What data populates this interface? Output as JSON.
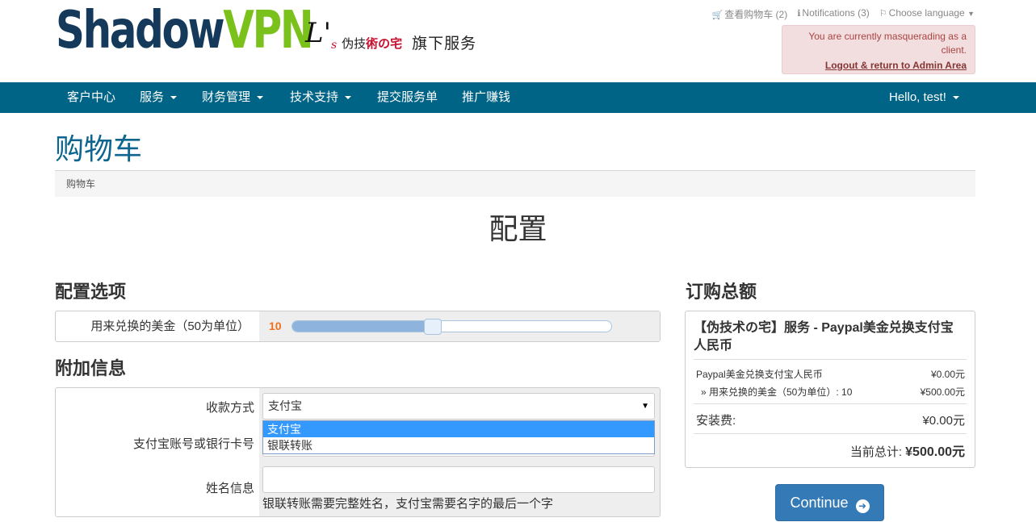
{
  "header": {
    "logo_part1": "Shadow",
    "logo_part2": "VPN",
    "partner_mark": "L'",
    "partner_mark_sub": "s",
    "partner_name_a": "伪技",
    "partner_name_b": "術の",
    "partner_name_c": "宅",
    "partner_tagline": "旗下服务",
    "cart_link": "查看购物车 (2)",
    "notifications_link": "Notifications (3)",
    "language_link": "Choose language",
    "masquerade_text": "You are currently masquerading as a client.",
    "masquerade_link": "Logout & return to Admin Area"
  },
  "nav": {
    "items": [
      {
        "label": "客户中心"
      },
      {
        "label": "服务"
      },
      {
        "label": "财务管理"
      },
      {
        "label": "技术支持"
      },
      {
        "label": "提交服务单"
      },
      {
        "label": "推广赚钱"
      }
    ],
    "user": "Hello, test!"
  },
  "page": {
    "title": "购物车",
    "breadcrumb": "购物车",
    "heading": "配置"
  },
  "config": {
    "heading": "配置选项",
    "option_label": "用来兑换的美金（50为单位）",
    "option_value": "10",
    "slider_fraction": 0.44
  },
  "additional": {
    "heading": "附加信息",
    "payment_label": "收款方式",
    "payment_selected": "支付宝",
    "payment_options": [
      "支付宝",
      "银联转账"
    ],
    "account_label": "支付宝账号或银行卡号",
    "account_value": "",
    "name_label": "姓名信息",
    "name_value": "",
    "name_hint": "银联转账需要完整姓名，支付宝需要名字的最后一个字"
  },
  "summary": {
    "heading": "订购总额",
    "product_title": "【伪技术の宅】服务 - Paypal美金兑换支付宝人民币",
    "line_item": "Paypal美金兑换支付宝人民币",
    "line_item_price": "¥0.00元",
    "sub_item": "» 用来兑换的美金（50为单位）: 10",
    "sub_item_price": "¥500.00元",
    "setup_label": "安装费:",
    "setup_price": "¥0.00元",
    "total_label": "当前总计:",
    "total_value": "¥500.00元",
    "continue_label": "Continue"
  }
}
